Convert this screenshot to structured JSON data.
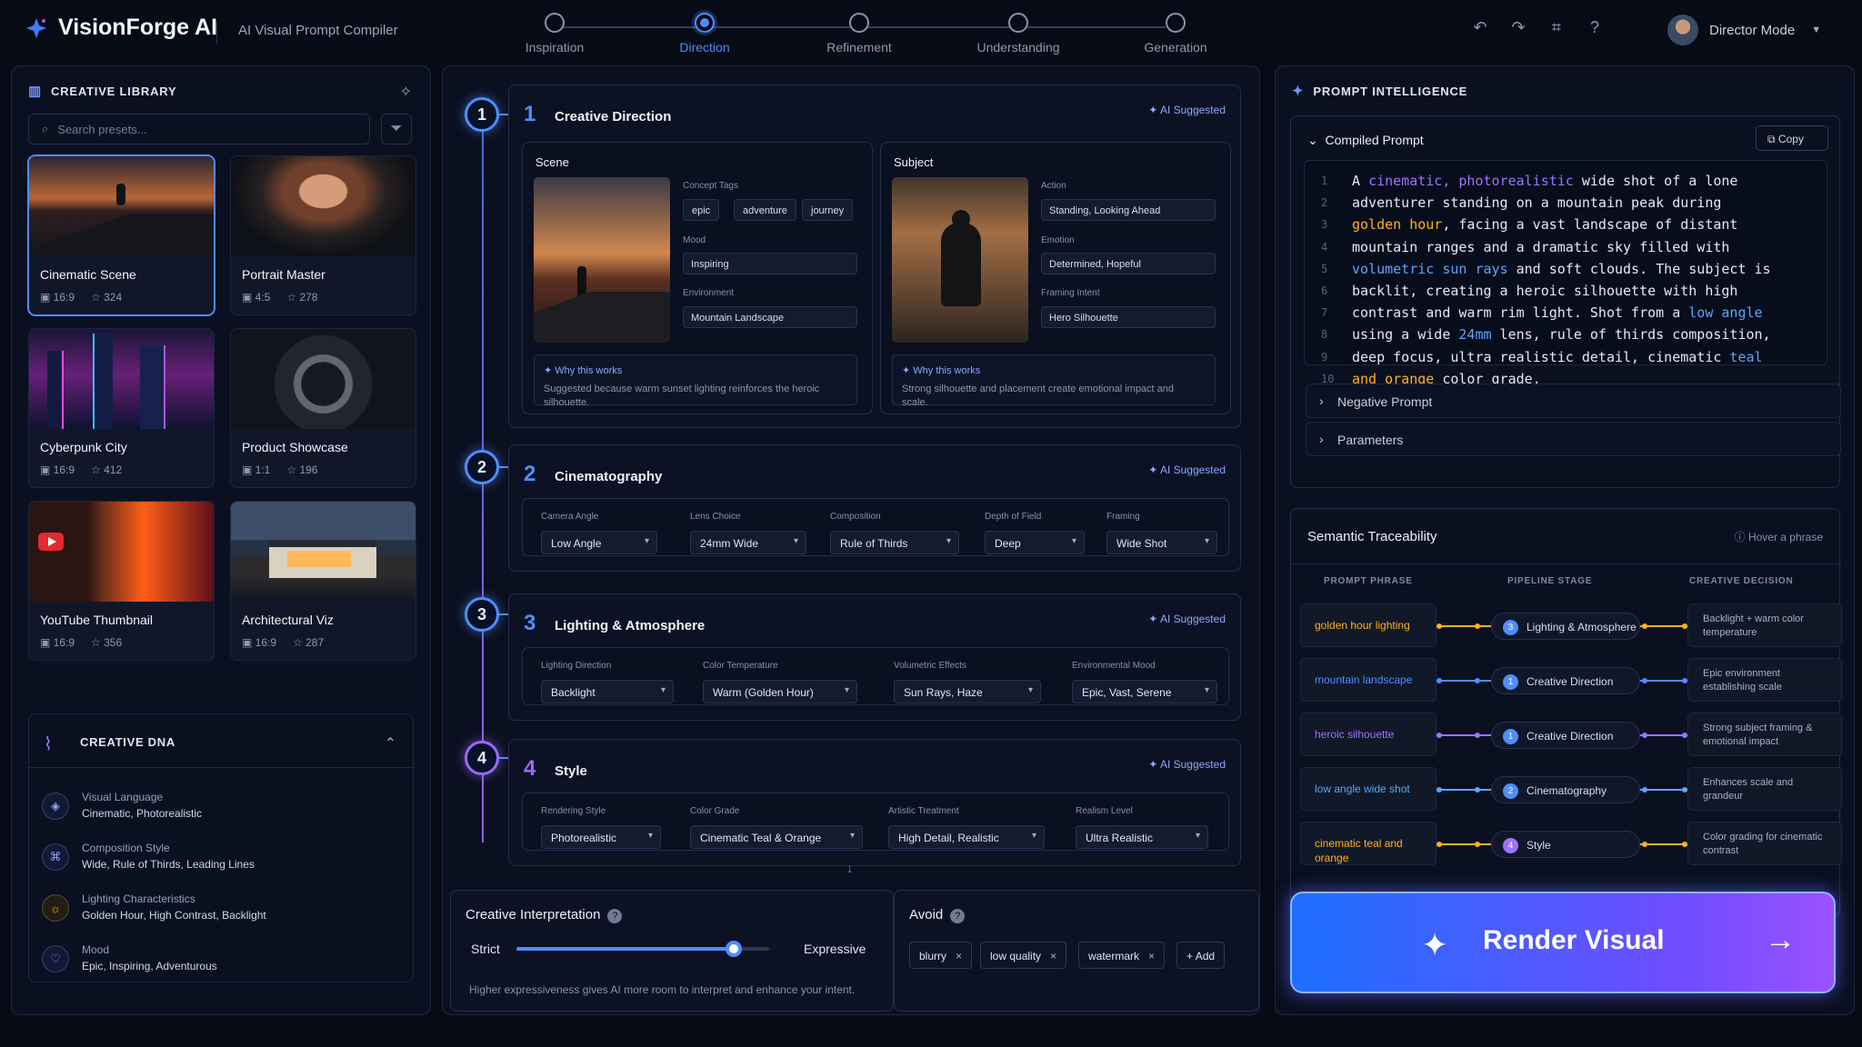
{
  "app": {
    "name": "VisionForge AI",
    "subtitle": "AI Visual Prompt Compiler",
    "user": "Director Mode"
  },
  "steps": [
    "Inspiration",
    "Direction",
    "Refinement",
    "Understanding",
    "Generation"
  ],
  "active_step": "Direction",
  "library": {
    "title": "CREATIVE LIBRARY",
    "search_placeholder": "Search presets...",
    "presets": [
      {
        "title": "Cinematic Scene",
        "ratio": "16:9",
        "stars": "324"
      },
      {
        "title": "Portrait Master",
        "ratio": "4:5",
        "stars": "278"
      },
      {
        "title": "Cyberpunk City",
        "ratio": "16:9",
        "stars": "412"
      },
      {
        "title": "Product Showcase",
        "ratio": "1:1",
        "stars": "196"
      },
      {
        "title": "YouTube Thumbnail",
        "ratio": "16:9",
        "stars": "356"
      },
      {
        "title": "Architectural Viz",
        "ratio": "16:9",
        "stars": "287"
      }
    ]
  },
  "dna": {
    "title": "CREATIVE DNA",
    "items": [
      {
        "label": "Visual Language",
        "value": "Cinematic, Photorealistic"
      },
      {
        "label": "Composition Style",
        "value": "Wide, Rule of Thirds, Leading Lines"
      },
      {
        "label": "Lighting Characteristics",
        "value": "Golden Hour, High Contrast, Backlight"
      },
      {
        "label": "Mood",
        "value": "Epic, Inspiring, Adventurous"
      }
    ]
  },
  "creative_direction": {
    "number": "1",
    "title": "Creative Direction",
    "ai_label": "AI Suggested",
    "scene": {
      "title": "Scene",
      "concept_tags_label": "Concept Tags",
      "tags": [
        "epic",
        "adventure",
        "journey"
      ],
      "mood_label": "Mood",
      "mood": "Inspiring",
      "environment_label": "Environment",
      "environment": "Mountain Landscape",
      "why_title": "Why this works",
      "why_text": "Suggested because warm sunset lighting reinforces the heroic silhouette."
    },
    "subject": {
      "title": "Subject",
      "action_label": "Action",
      "action": "Standing, Looking Ahead",
      "emotion_label": "Emotion",
      "emotion": "Determined, Hopeful",
      "framing_label": "Framing Intent",
      "framing": "Hero Silhouette",
      "why_title": "Why this works",
      "why_text": "Strong silhouette and placement create emotional impact and scale."
    }
  },
  "cinematography": {
    "number": "2",
    "title": "Cinematography",
    "ai_label": "AI Suggested",
    "fields": [
      {
        "label": "Camera Angle",
        "value": "Low Angle"
      },
      {
        "label": "Lens Choice",
        "value": "24mm Wide"
      },
      {
        "label": "Composition",
        "value": "Rule of Thirds"
      },
      {
        "label": "Depth of Field",
        "value": "Deep"
      },
      {
        "label": "Framing",
        "value": "Wide Shot"
      }
    ]
  },
  "lighting": {
    "number": "3",
    "title": "Lighting & Atmosphere",
    "ai_label": "AI Suggested",
    "fields": [
      {
        "label": "Lighting Direction",
        "value": "Backlight"
      },
      {
        "label": "Color Temperature",
        "value": "Warm (Golden Hour)"
      },
      {
        "label": "Volumetric Effects",
        "value": "Sun Rays, Haze"
      },
      {
        "label": "Environmental Mood",
        "value": "Epic, Vast, Serene"
      }
    ]
  },
  "style": {
    "number": "4",
    "title": "Style",
    "ai_label": "AI Suggested",
    "fields": [
      {
        "label": "Rendering Style",
        "value": "Photorealistic"
      },
      {
        "label": "Color Grade",
        "value": "Cinematic Teal & Orange"
      },
      {
        "label": "Artistic Treatment",
        "value": "High Detail, Realistic"
      },
      {
        "label": "Realism Level",
        "value": "Ultra Realistic"
      }
    ]
  },
  "interpretation": {
    "title": "Creative Interpretation",
    "left": "Strict",
    "right": "Expressive",
    "level": 0.86,
    "hint": "Higher expressiveness gives AI more room to interpret and enhance your intent."
  },
  "avoid": {
    "title": "Avoid",
    "chips": [
      "blurry",
      "low quality",
      "watermark"
    ],
    "add_label": "Add"
  },
  "prompt_panel": {
    "title": "PROMPT INTELLIGENCE",
    "compiled_title": "Compiled Prompt",
    "copy_label": "Copy",
    "negative_label": "Negative Prompt",
    "parameters_label": "Parameters",
    "lines": [
      [
        "A ",
        "cinematic, photorealistic",
        " wide shot of a lone"
      ],
      [
        "adventurer standing on a mountain peak during",
        "",
        ""
      ],
      [
        "golden hour",
        ", facing a vast landscape of distant",
        ""
      ],
      [
        "mountain ranges and a dramatic sky filled with",
        "",
        ""
      ],
      [
        "volumetric sun rays",
        " and soft clouds. The subject is",
        ""
      ],
      [
        "backlit, creating a heroic silhouette with high",
        "",
        ""
      ],
      [
        "contrast and warm rim light. Shot from a ",
        "low angle",
        ""
      ],
      [
        "using a wide ",
        "24mm",
        " lens, rule of thirds composition,"
      ],
      [
        "deep focus, ultra realistic detail, cinematic ",
        "teal",
        ""
      ],
      [
        "and orange",
        " color grade.",
        ""
      ]
    ]
  },
  "traceability": {
    "title": "Semantic Traceability",
    "hover": "Hover a phrase",
    "headers": [
      "PROMPT PHRASE",
      "PIPELINE STAGE",
      "CREATIVE DECISION"
    ],
    "rows": [
      {
        "phrase": "golden hour lighting",
        "stage_num": "3",
        "stage": "Lighting & Atmosphere",
        "decision": "Backlight + warm color temperature",
        "color": "#ffb020"
      },
      {
        "phrase": "mountain landscape",
        "stage_num": "1",
        "stage": "Creative Direction",
        "decision": "Epic environment establishing scale",
        "color": "#4f8dff"
      },
      {
        "phrase": "heroic silhouette",
        "stage_num": "1",
        "stage": "Creative Direction",
        "decision": "Strong subject framing & emotional impact",
        "color": "#9b72ff"
      },
      {
        "phrase": "low angle wide shot",
        "stage_num": "2",
        "stage": "Cinematography",
        "decision": "Enhances scale and grandeur",
        "color": "#58a6ff"
      },
      {
        "phrase": "cinematic teal and orange",
        "stage_num": "4",
        "stage": "Style",
        "decision": "Color grading for cinematic contrast",
        "color": "#ffb020"
      }
    ]
  },
  "render_label": "Render Visual",
  "colors": {
    "accent": "#4f8dff",
    "purple": "#9b72ff",
    "orange": "#ffb020",
    "background": "#070b16"
  }
}
